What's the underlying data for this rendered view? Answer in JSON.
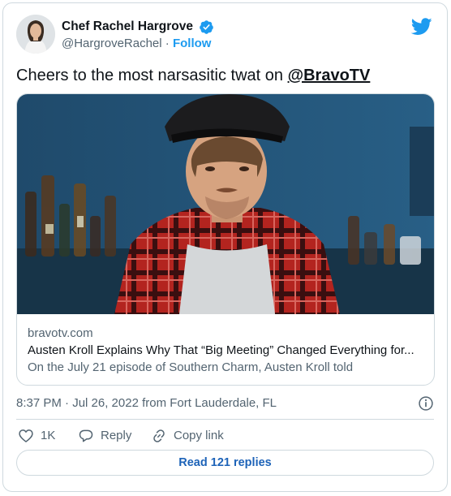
{
  "header": {
    "display_name": "Chef Rachel Hargrove",
    "handle": "@HargroveRachel",
    "separator": "·",
    "follow_label": "Follow"
  },
  "tweet": {
    "text": "Cheers to the most narsasitic twat on ",
    "mention": "@BravoTV"
  },
  "link_card": {
    "domain": "bravotv.com",
    "title": "Austen Kroll Explains Why That “Big Meeting” Changed Everything for...",
    "description": "On the July 21 episode of Southern Charm, Austen Kroll told"
  },
  "meta": {
    "timestamp": "8:37 PM · Jul 26, 2022 from Fort Lauderdale, FL"
  },
  "actions": {
    "like_count": "1K",
    "reply_label": "Reply",
    "copy_link_label": "Copy link"
  },
  "replies": {
    "read_label": "Read 121 replies"
  },
  "colors": {
    "twitter_blue": "#1d9bf0",
    "verified_blue": "#1d9bf0",
    "text_secondary": "#536471",
    "border": "#cfd9de"
  },
  "icons": [
    "verified-badge-icon",
    "twitter-bird-icon",
    "info-icon",
    "heart-icon",
    "reply-bubble-icon",
    "link-icon"
  ]
}
